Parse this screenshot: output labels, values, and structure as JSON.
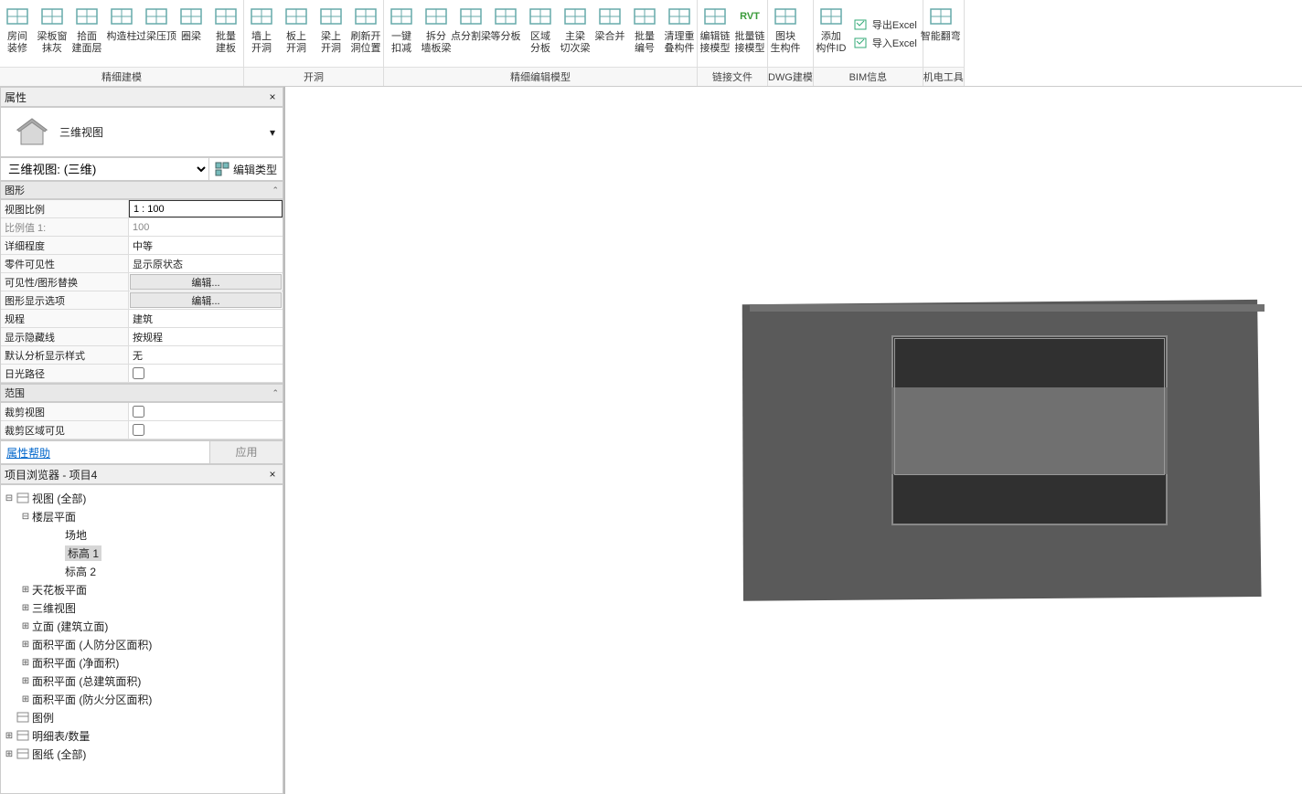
{
  "ribbon": {
    "groups": [
      {
        "title": "精细建模",
        "buttons": [
          {
            "name": "room-decor",
            "label": "房间\n装修"
          },
          {
            "name": "beam-slab-window",
            "label": "梁板窗\n抹灰"
          },
          {
            "name": "pick-face",
            "label": "拾面\n建面层"
          },
          {
            "name": "struct-column",
            "label": "构造柱"
          },
          {
            "name": "lintel-top",
            "label": "过梁压顶"
          },
          {
            "name": "ring-beam",
            "label": "圈梁"
          },
          {
            "name": "batch-slab",
            "label": "批量\n建板"
          }
        ]
      },
      {
        "title": "开洞",
        "buttons": [
          {
            "name": "wall-open",
            "label": "墙上\n开洞"
          },
          {
            "name": "slab-open",
            "label": "板上\n开洞"
          },
          {
            "name": "beam-open",
            "label": "梁上\n开洞"
          },
          {
            "name": "refresh-open",
            "label": "刷新开\n洞位置"
          }
        ]
      },
      {
        "title": "精细编辑模型",
        "buttons": [
          {
            "name": "one-click-deduct",
            "label": "一键\n扣减"
          },
          {
            "name": "split-wallbeam",
            "label": "拆分\n墙板梁"
          },
          {
            "name": "point-split-beam",
            "label": "点分割梁"
          },
          {
            "name": "equal-split",
            "label": "等分板"
          },
          {
            "name": "region-split",
            "label": "区域\n分板"
          },
          {
            "name": "main-beam-cut",
            "label": "主梁\n切次梁"
          },
          {
            "name": "beam-merge",
            "label": "梁合并"
          },
          {
            "name": "batch-number",
            "label": "批量\n编号"
          },
          {
            "name": "clean-dup",
            "label": "清理重\n叠构件"
          }
        ]
      },
      {
        "title": "链接文件",
        "buttons": [
          {
            "name": "edit-link-model",
            "label": "编辑链\n接模型"
          },
          {
            "name": "batch-link-model",
            "label": "批量链\n接模型",
            "rvt": true
          }
        ]
      },
      {
        "title": "DWG建模",
        "buttons": [
          {
            "name": "dwg-block-gen",
            "label": "图块\n生构件"
          }
        ]
      },
      {
        "title": "BIM信息",
        "main": [
          {
            "name": "add-member-id",
            "label": "添加\n构件ID"
          }
        ],
        "side": [
          {
            "name": "export-excel",
            "label": "导出Excel"
          },
          {
            "name": "import-excel",
            "label": "导入Excel"
          }
        ]
      },
      {
        "title": "机电工具",
        "buttons": [
          {
            "name": "smart-bend",
            "label": "智能翻弯"
          }
        ]
      }
    ]
  },
  "properties": {
    "panel_title": "属性",
    "type_label": "三维视图",
    "instance_label": "三维视图: (三维)",
    "edit_type": "编辑类型",
    "cat_graphic": "图形",
    "cat_extents": "范围",
    "rows_graphic": [
      {
        "name": "view-scale",
        "label": "视图比例",
        "value": "1 : 100",
        "input": true
      },
      {
        "name": "scale-value",
        "label": "比例值 1:",
        "value": "100",
        "disabled": true
      },
      {
        "name": "detail-level",
        "label": "详细程度",
        "value": "中等"
      },
      {
        "name": "part-visibility",
        "label": "零件可见性",
        "value": "显示原状态"
      },
      {
        "name": "vis-graphic-override",
        "label": "可见性/图形替换",
        "btn": "编辑..."
      },
      {
        "name": "graphic-display-opts",
        "label": "图形显示选项",
        "btn": "编辑..."
      },
      {
        "name": "discipline",
        "label": "规程",
        "value": "建筑"
      },
      {
        "name": "show-hidden-lines",
        "label": "显示隐藏线",
        "value": "按规程"
      },
      {
        "name": "default-analysis-style",
        "label": "默认分析显示样式",
        "value": "无"
      },
      {
        "name": "sun-path",
        "label": "日光路径",
        "checkbox": false
      }
    ],
    "rows_extents": [
      {
        "name": "crop-view",
        "label": "裁剪视图",
        "checkbox": false
      },
      {
        "name": "crop-region-visible",
        "label": "裁剪区域可见",
        "checkbox": false
      }
    ],
    "help": "属性帮助",
    "apply": "应用"
  },
  "browser": {
    "panel_title": "项目浏览器 - 项目4",
    "tree": [
      {
        "indent": 0,
        "toggle": "⊟",
        "icon": "views",
        "label": "视图 (全部)"
      },
      {
        "indent": 1,
        "toggle": "⊟",
        "label": "楼层平面"
      },
      {
        "indent": 3,
        "label": "场地"
      },
      {
        "indent": 3,
        "label": "标高 1",
        "selected": true
      },
      {
        "indent": 3,
        "label": "标高 2"
      },
      {
        "indent": 1,
        "toggle": "⊞",
        "label": "天花板平面"
      },
      {
        "indent": 1,
        "toggle": "⊞",
        "label": "三维视图"
      },
      {
        "indent": 1,
        "toggle": "⊞",
        "label": "立面 (建筑立面)"
      },
      {
        "indent": 1,
        "toggle": "⊞",
        "label": "面积平面 (人防分区面积)"
      },
      {
        "indent": 1,
        "toggle": "⊞",
        "label": "面积平面 (净面积)"
      },
      {
        "indent": 1,
        "toggle": "⊞",
        "label": "面积平面 (总建筑面积)"
      },
      {
        "indent": 1,
        "toggle": "⊞",
        "label": "面积平面 (防火分区面积)"
      },
      {
        "indent": 0,
        "toggle": "",
        "icon": "legend",
        "label": "图例"
      },
      {
        "indent": 0,
        "toggle": "⊞",
        "icon": "schedule",
        "label": "明细表/数量"
      },
      {
        "indent": 0,
        "toggle": "⊞",
        "icon": "sheet",
        "label": "图纸 (全部)"
      }
    ]
  }
}
